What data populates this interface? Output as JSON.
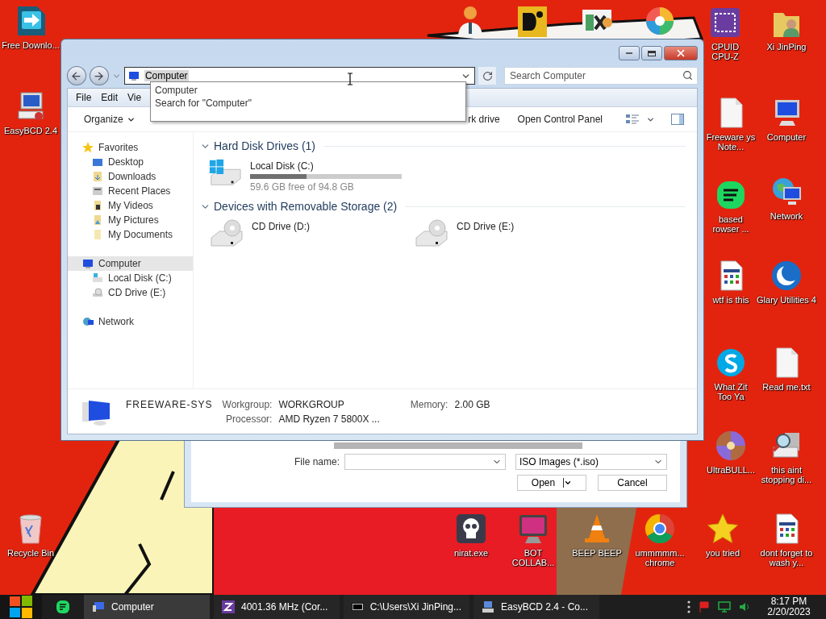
{
  "desktop_icons": [
    {
      "kind": "download-app",
      "label": "Free Downlo..."
    },
    {
      "kind": "repair-computer",
      "label": "EasyBCD 2.4"
    },
    {
      "kind": "doctor"
    },
    {
      "kind": "gold-tile"
    },
    {
      "kind": "hex-tile"
    },
    {
      "kind": "color-wheel"
    },
    {
      "kind": "chip-app",
      "label": "CPUID CPU-Z"
    },
    {
      "kind": "user-folder",
      "label": "Xi JinPing"
    },
    {
      "kind": "blank-document",
      "label": "Freeware ys Note..."
    },
    {
      "kind": "computer",
      "label": "Computer"
    },
    {
      "kind": "chat-app",
      "label": "based rowser ..."
    },
    {
      "kind": "network",
      "label": "Network"
    },
    {
      "kind": "app-document",
      "label": "wtf is this"
    },
    {
      "kind": "crescent-app",
      "label": "Glary Utilities 4"
    },
    {
      "kind": "call-app",
      "label": "What Zit Too Ya"
    },
    {
      "kind": "blank-document",
      "label": "Read me.txt"
    },
    {
      "kind": "disc",
      "label": "UltraBULL..."
    },
    {
      "kind": "magnifier-computer",
      "label": "this aint stopping di..."
    },
    {
      "kind": "recycle-bin",
      "label": "Recycle Bin"
    },
    {
      "kind": "skull-app",
      "label": "nirat.exe"
    },
    {
      "kind": "pink-monitor",
      "label": "BOT COLLAB..."
    },
    {
      "kind": "cone",
      "label": "BEEP BEEP"
    },
    {
      "kind": "browser-ball",
      "label": "ummmmm... chrome"
    },
    {
      "kind": "star",
      "label": "you tried"
    },
    {
      "kind": "app-document",
      "label": "dont forget to wash y..."
    }
  ],
  "open_dialog": {
    "file_name_label": "File name:",
    "file_type": "ISO Images (*.iso)",
    "buttons": [
      {
        "label": "Open",
        "kind": "split"
      },
      {
        "label": "Cancel",
        "kind": "plain"
      }
    ]
  },
  "explorer": {
    "address": {
      "value": "Computer",
      "text_selected": true
    },
    "search": {
      "placeholder": "Search Computer"
    },
    "autocomplete": [
      "Computer",
      "Search for \"Computer\""
    ],
    "menu": [
      "File",
      "Edit",
      "Vie"
    ],
    "toolbar": [
      {
        "label": "Organize",
        "has_menu": true
      },
      {
        "label": "rk drive",
        "has_menu": false
      },
      {
        "label": "Open Control Panel",
        "has_menu": false
      }
    ],
    "nav_pane": [
      {
        "kind": "star",
        "label": "Favorites",
        "selected": false,
        "children": [
          {
            "kind": "desktop",
            "label": "Desktop",
            "selected": false
          },
          {
            "kind": "downloads",
            "label": "Downloads",
            "selected": false
          },
          {
            "kind": "recent",
            "label": "Recent Places",
            "selected": false
          },
          {
            "kind": "videos",
            "label": "My Videos",
            "selected": false
          },
          {
            "kind": "pictures",
            "label": "My Pictures",
            "selected": false
          },
          {
            "kind": "documents",
            "label": "My Documents",
            "selected": false
          }
        ]
      },
      {
        "kind": "computer",
        "label": "Computer",
        "selected": true,
        "children": [
          {
            "kind": "disk",
            "label": "Local Disk (C:)",
            "selected": false
          },
          {
            "kind": "cd",
            "label": "CD Drive (E:)",
            "selected": false
          }
        ]
      },
      {
        "kind": "network",
        "label": "Network",
        "selected": false
      }
    ],
    "groups": [
      {
        "title": "Hard Disk Drives (1)",
        "expanded": true,
        "items": [
          {
            "kind": "hard-disk",
            "name": "Local Disk (C:)",
            "level": 0.37,
            "reading": "59.6 GB free of 94.8 GB"
          }
        ]
      },
      {
        "title": "Devices with Removable Storage (2)",
        "expanded": true,
        "items": [
          {
            "kind": "cd-drive",
            "name": "CD Drive (D:)"
          },
          {
            "kind": "cd-drive",
            "name": "CD Drive (E:)"
          }
        ]
      }
    ],
    "details": {
      "computer_name": "FREEWARE-SYS",
      "fields": [
        {
          "label": "Workgroup:",
          "value": "WORKGROUP"
        },
        {
          "label": "Memory:",
          "value": "2.00 GB"
        },
        {
          "label": "Processor:",
          "value": "AMD Ryzen 7 5800X ..."
        }
      ]
    }
  },
  "taskbar": {
    "tasks": [
      {
        "kind": "computer",
        "label": "Computer",
        "selected": true
      },
      {
        "kind": "chip",
        "label": "4001.36 MHz (Cor...",
        "selected": false
      },
      {
        "kind": "archive",
        "label": "C:\\Users\\Xi JinPing...",
        "selected": false
      },
      {
        "kind": "repair",
        "label": "EasyBCD 2.4 - Co...",
        "selected": false
      }
    ],
    "clock": {
      "time": "8:17 PM",
      "date": "2/20/2023"
    }
  }
}
